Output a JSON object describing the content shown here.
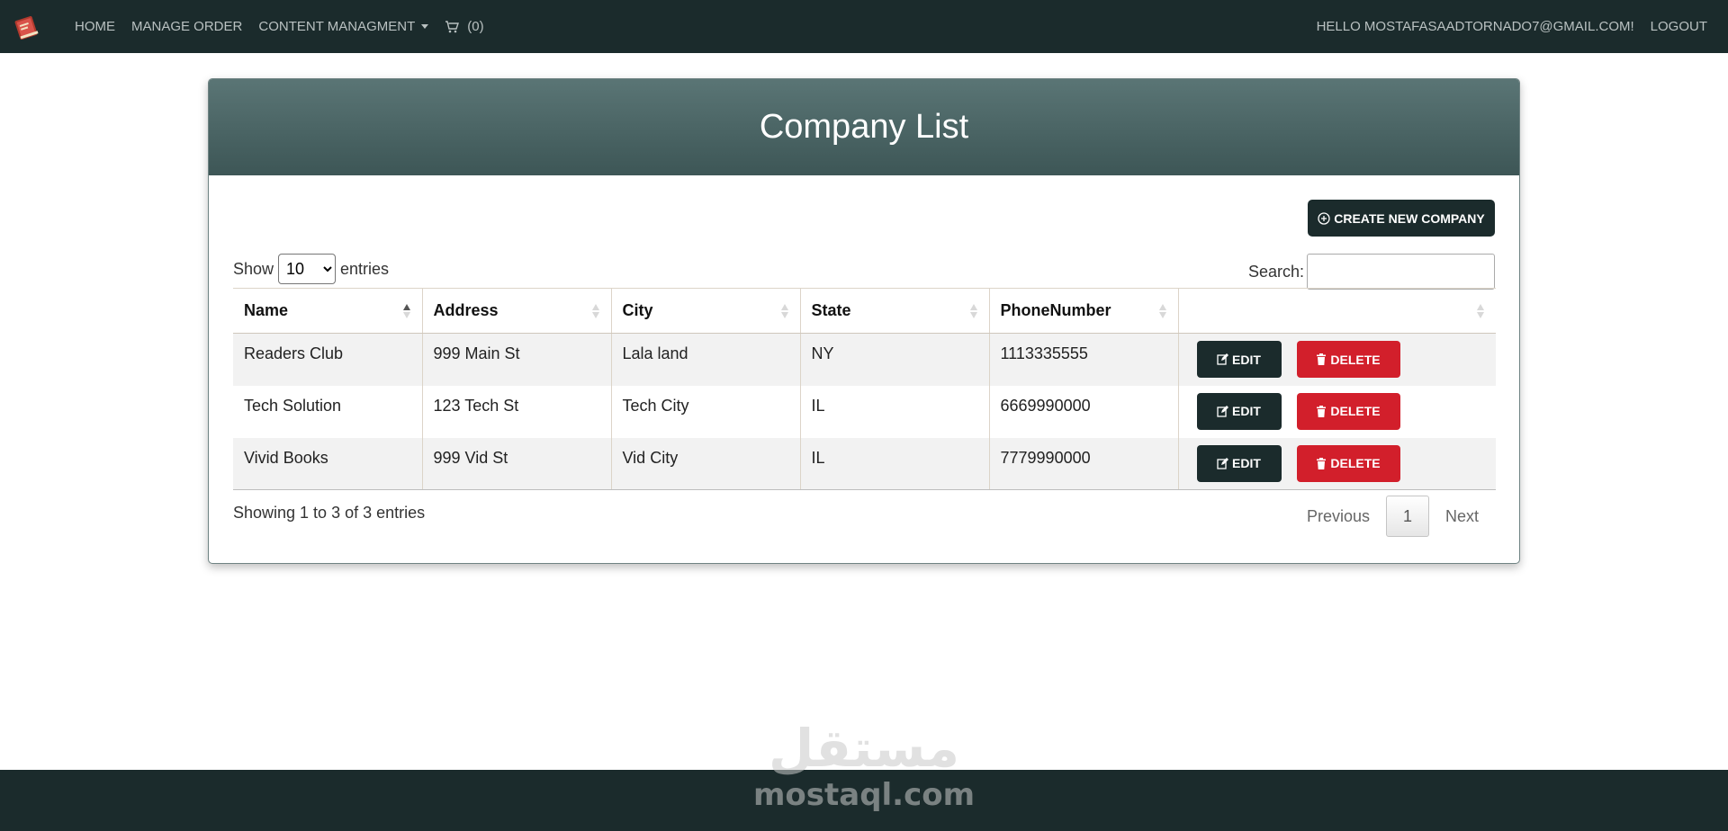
{
  "navbar": {
    "brand_icon": "book-logo-icon",
    "links": {
      "home": "HOME",
      "manage_order": "MANAGE ORDER",
      "content_management": "CONTENT MANAGMENT",
      "cart_count": "(0)"
    },
    "greeting": "HELLO MOSTAFASAADTORNADO7@GMAIL.COM!",
    "logout": "LOGOUT"
  },
  "card": {
    "title": "Company List",
    "create_button": "CREATE NEW COMPANY"
  },
  "table_controls": {
    "show_label": "Show",
    "page_length": "10",
    "page_length_options": [
      "10"
    ],
    "entries_label": "entries",
    "search_label": "Search:",
    "search_value": ""
  },
  "table": {
    "columns": [
      "Name",
      "Address",
      "City",
      "State",
      "PhoneNumber",
      ""
    ],
    "sorted_column": "Name",
    "sort_direction": "ascending",
    "rows": [
      {
        "name": "Readers Club",
        "address": "999 Main St",
        "city": "Lala land",
        "state": "NY",
        "phone": "1113335555"
      },
      {
        "name": "Tech Solution",
        "address": "123 Tech St",
        "city": "Tech City",
        "state": "IL",
        "phone": "6669990000"
      },
      {
        "name": "Vivid Books",
        "address": "999 Vid St",
        "city": "Vid City",
        "state": "IL",
        "phone": "7779990000"
      }
    ],
    "edit_label": "EDIT",
    "delete_label": "DELETE"
  },
  "footer_info": {
    "info": "Showing 1 to 3 of 3 entries",
    "previous": "Previous",
    "current_page": "1",
    "next": "Next"
  },
  "watermark": {
    "arabic": "مستقل",
    "latin": "mostaql.com"
  },
  "colors": {
    "navbar": "#1b2b2c",
    "header_gradient_top": "#5a7575",
    "header_gradient_bottom": "#3d5656",
    "edit_button": "#1b2b2c",
    "delete_button": "#d21f2b"
  }
}
